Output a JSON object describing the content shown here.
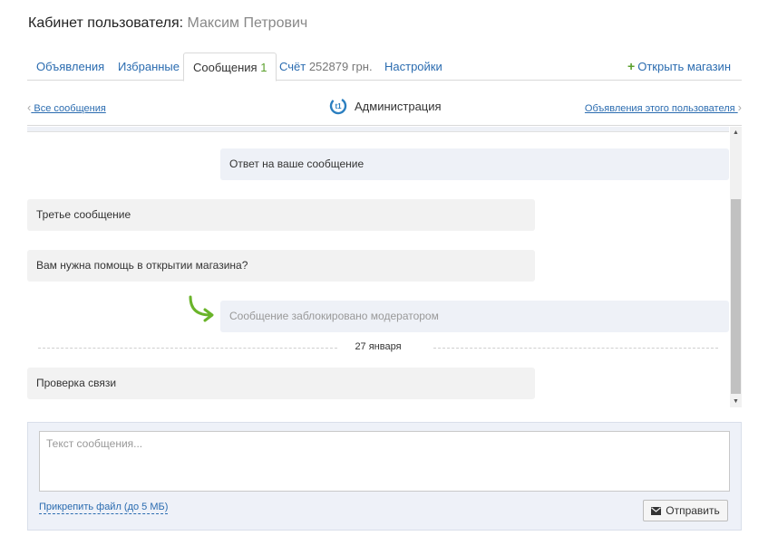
{
  "header": {
    "title": "Кабинет пользователя:",
    "user_name": "Максим Петрович"
  },
  "tabs": {
    "ads": "Объявления",
    "favorites": "Избранные",
    "messages": "Сообщения",
    "messages_count": "1",
    "account": "Счёт",
    "account_balance": "252879 грн.",
    "settings": "Настройки",
    "open_shop": "Открыть магазин"
  },
  "conversation": {
    "back_label": "Все сообщения",
    "title": "Администрация",
    "user_ads_label": "Объявления этого пользователя"
  },
  "messages": [
    {
      "direction": "out",
      "text": "Ответ на ваше сообщение"
    },
    {
      "direction": "in",
      "text": "Третье сообщение"
    },
    {
      "direction": "in",
      "text": "Вам нужна помощь в открытии магазина?"
    },
    {
      "direction": "out",
      "text": "Сообщение заблокировано модератором",
      "blocked": true
    },
    {
      "direction": "in",
      "text": "Проверка связи"
    }
  ],
  "date_separator": "27 января",
  "composer": {
    "placeholder": "Текст сообщения...",
    "attach_label": "Прикрепить файл (до 5 МБ)",
    "send_label": "Отправить"
  },
  "colors": {
    "link": "#2b6cb0",
    "accent_green": "#5aa02c",
    "incoming_bg": "#f2f2f2",
    "outgoing_bg": "#eef1f7"
  },
  "icons": [
    "admin-logo-icon",
    "green-arrow-icon",
    "envelope-icon",
    "plus-icon",
    "chevron-left-icon",
    "chevron-right-icon"
  ]
}
